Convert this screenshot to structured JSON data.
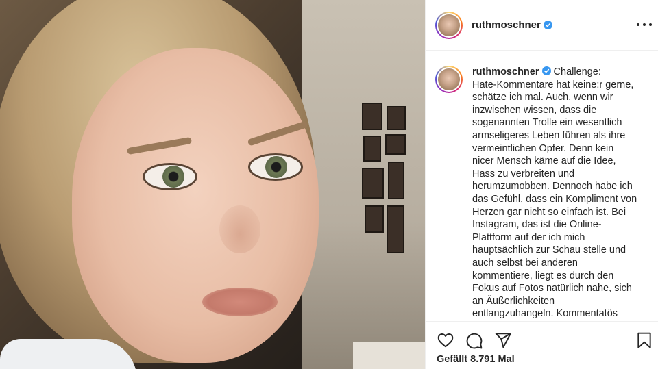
{
  "post": {
    "username": "ruthmoschner",
    "verified": true,
    "caption_lines": [
      "Challenge:",
      "Hate-Kommentare hat keine:r gerne,",
      "schätze ich mal. Auch, wenn wir",
      "inzwischen wissen, dass die",
      "sogenannten Trolle ein wesentlich",
      "armseligeres Leben führen als ihre",
      "vermeintlichen Opfer. Denn kein",
      "nicer Mensch käme auf die Idee,",
      "Hass zu verbreiten und",
      "herumzumobben. Dennoch habe ich",
      "das Gefühl, dass ein Kompliment von",
      "Herzen gar nicht so einfach ist. Bei",
      "Instagram, das ist die Online-",
      "Plattform auf der ich mich",
      "hauptsächlich zur Schau stelle und",
      "auch selbst bei anderen",
      "kommentiere, liegt es durch den",
      "Fokus auf Fotos natürlich nahe, sich",
      "an Äußerlichkeiten",
      "entlangzuhangeln. Kommentatös"
    ],
    "likes_text": "Gefällt 8.791 Mal"
  },
  "icons": {
    "verified": "verified-badge-icon",
    "more": "more-options-icon",
    "like": "heart-icon",
    "comment": "comment-icon",
    "share": "share-icon",
    "save": "bookmark-icon"
  },
  "colors": {
    "verified_blue": "#3897f0",
    "text": "#262626",
    "divider": "#efefef"
  }
}
